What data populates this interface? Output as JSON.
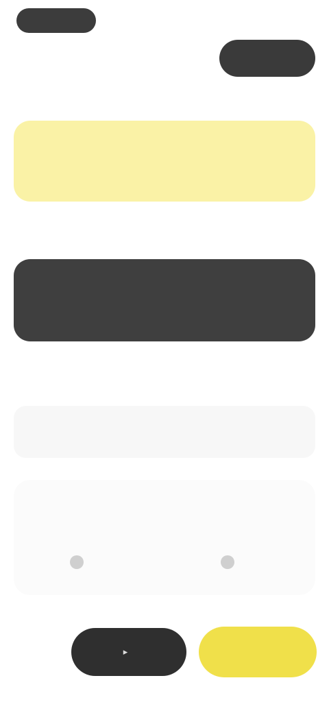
{
  "top": {
    "status_pill": "",
    "right_mark": "",
    "back_label": "",
    "action_label": ""
  },
  "sections": {
    "label_1": "",
    "label_2": "",
    "label_3": ""
  },
  "yellow_card": {
    "text": ""
  },
  "dark_card": {
    "line1": "",
    "line2": ""
  },
  "row": {
    "title": "",
    "value": ""
  },
  "info": {
    "title": "",
    "option_a": "",
    "option_b": ""
  },
  "bottom": {
    "left_label": "",
    "dark_button_label": "",
    "yellow_button_label": ""
  },
  "colors": {
    "accent_yellow": "#f0e04a",
    "card_yellow": "#faf2a6",
    "dark": "#3a3a3a",
    "background": "#ffffff"
  },
  "icons": {
    "dark_button_icon": "play-icon",
    "radio_icon": "radio-dot-icon"
  }
}
